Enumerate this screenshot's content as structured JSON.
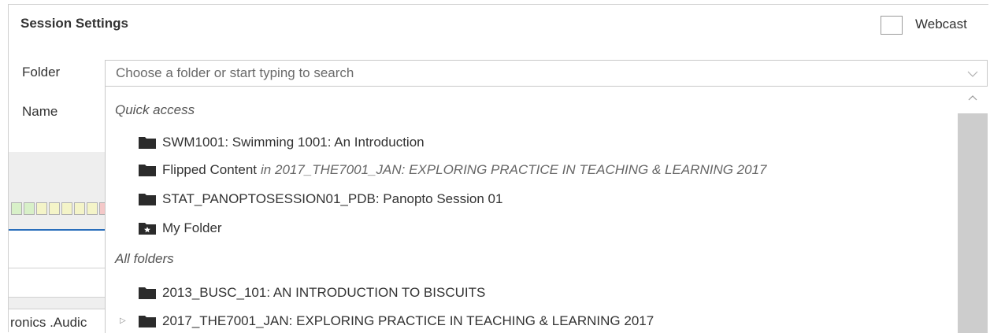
{
  "header": {
    "title": "Session Settings",
    "webcast_label": "Webcast",
    "webcast_checked": false
  },
  "form": {
    "folder_label": "Folder",
    "name_label": "Name",
    "folder_placeholder": "Choose a folder or start typing to search"
  },
  "background": {
    "partial_text": "ronics .Audic"
  },
  "dropdown": {
    "quick_access_header": "Quick access",
    "quick_access": [
      {
        "name": "SWM1001: Swimming 1001: An Introduction",
        "context": "",
        "icon": "folder-icon"
      },
      {
        "name": "Flipped Content",
        "context": "in 2017_THE7001_JAN: EXPLORING PRACTICE IN TEACHING & LEARNING 2017",
        "icon": "folder-icon"
      },
      {
        "name": "STAT_PANOPTOSESSION01_PDB: Panopto Session 01",
        "context": "",
        "icon": "folder-icon"
      },
      {
        "name": "My Folder",
        "context": "",
        "icon": "folder-star-icon"
      }
    ],
    "all_folders_header": "All folders",
    "all_folders": [
      {
        "name": "2013_BUSC_101: AN INTRODUCTION TO BISCUITS",
        "expandable": false,
        "icon": "folder-icon"
      },
      {
        "name": "2017_THE7001_JAN: EXPLORING PRACTICE IN TEACHING & LEARNING 2017",
        "expandable": true,
        "icon": "folder-icon"
      }
    ]
  },
  "colors": {
    "accent": "#2a6ebb",
    "meter_green": "#d8f0c8",
    "meter_yellow": "#f4f4c8",
    "meter_red": "#f4c8c8"
  }
}
